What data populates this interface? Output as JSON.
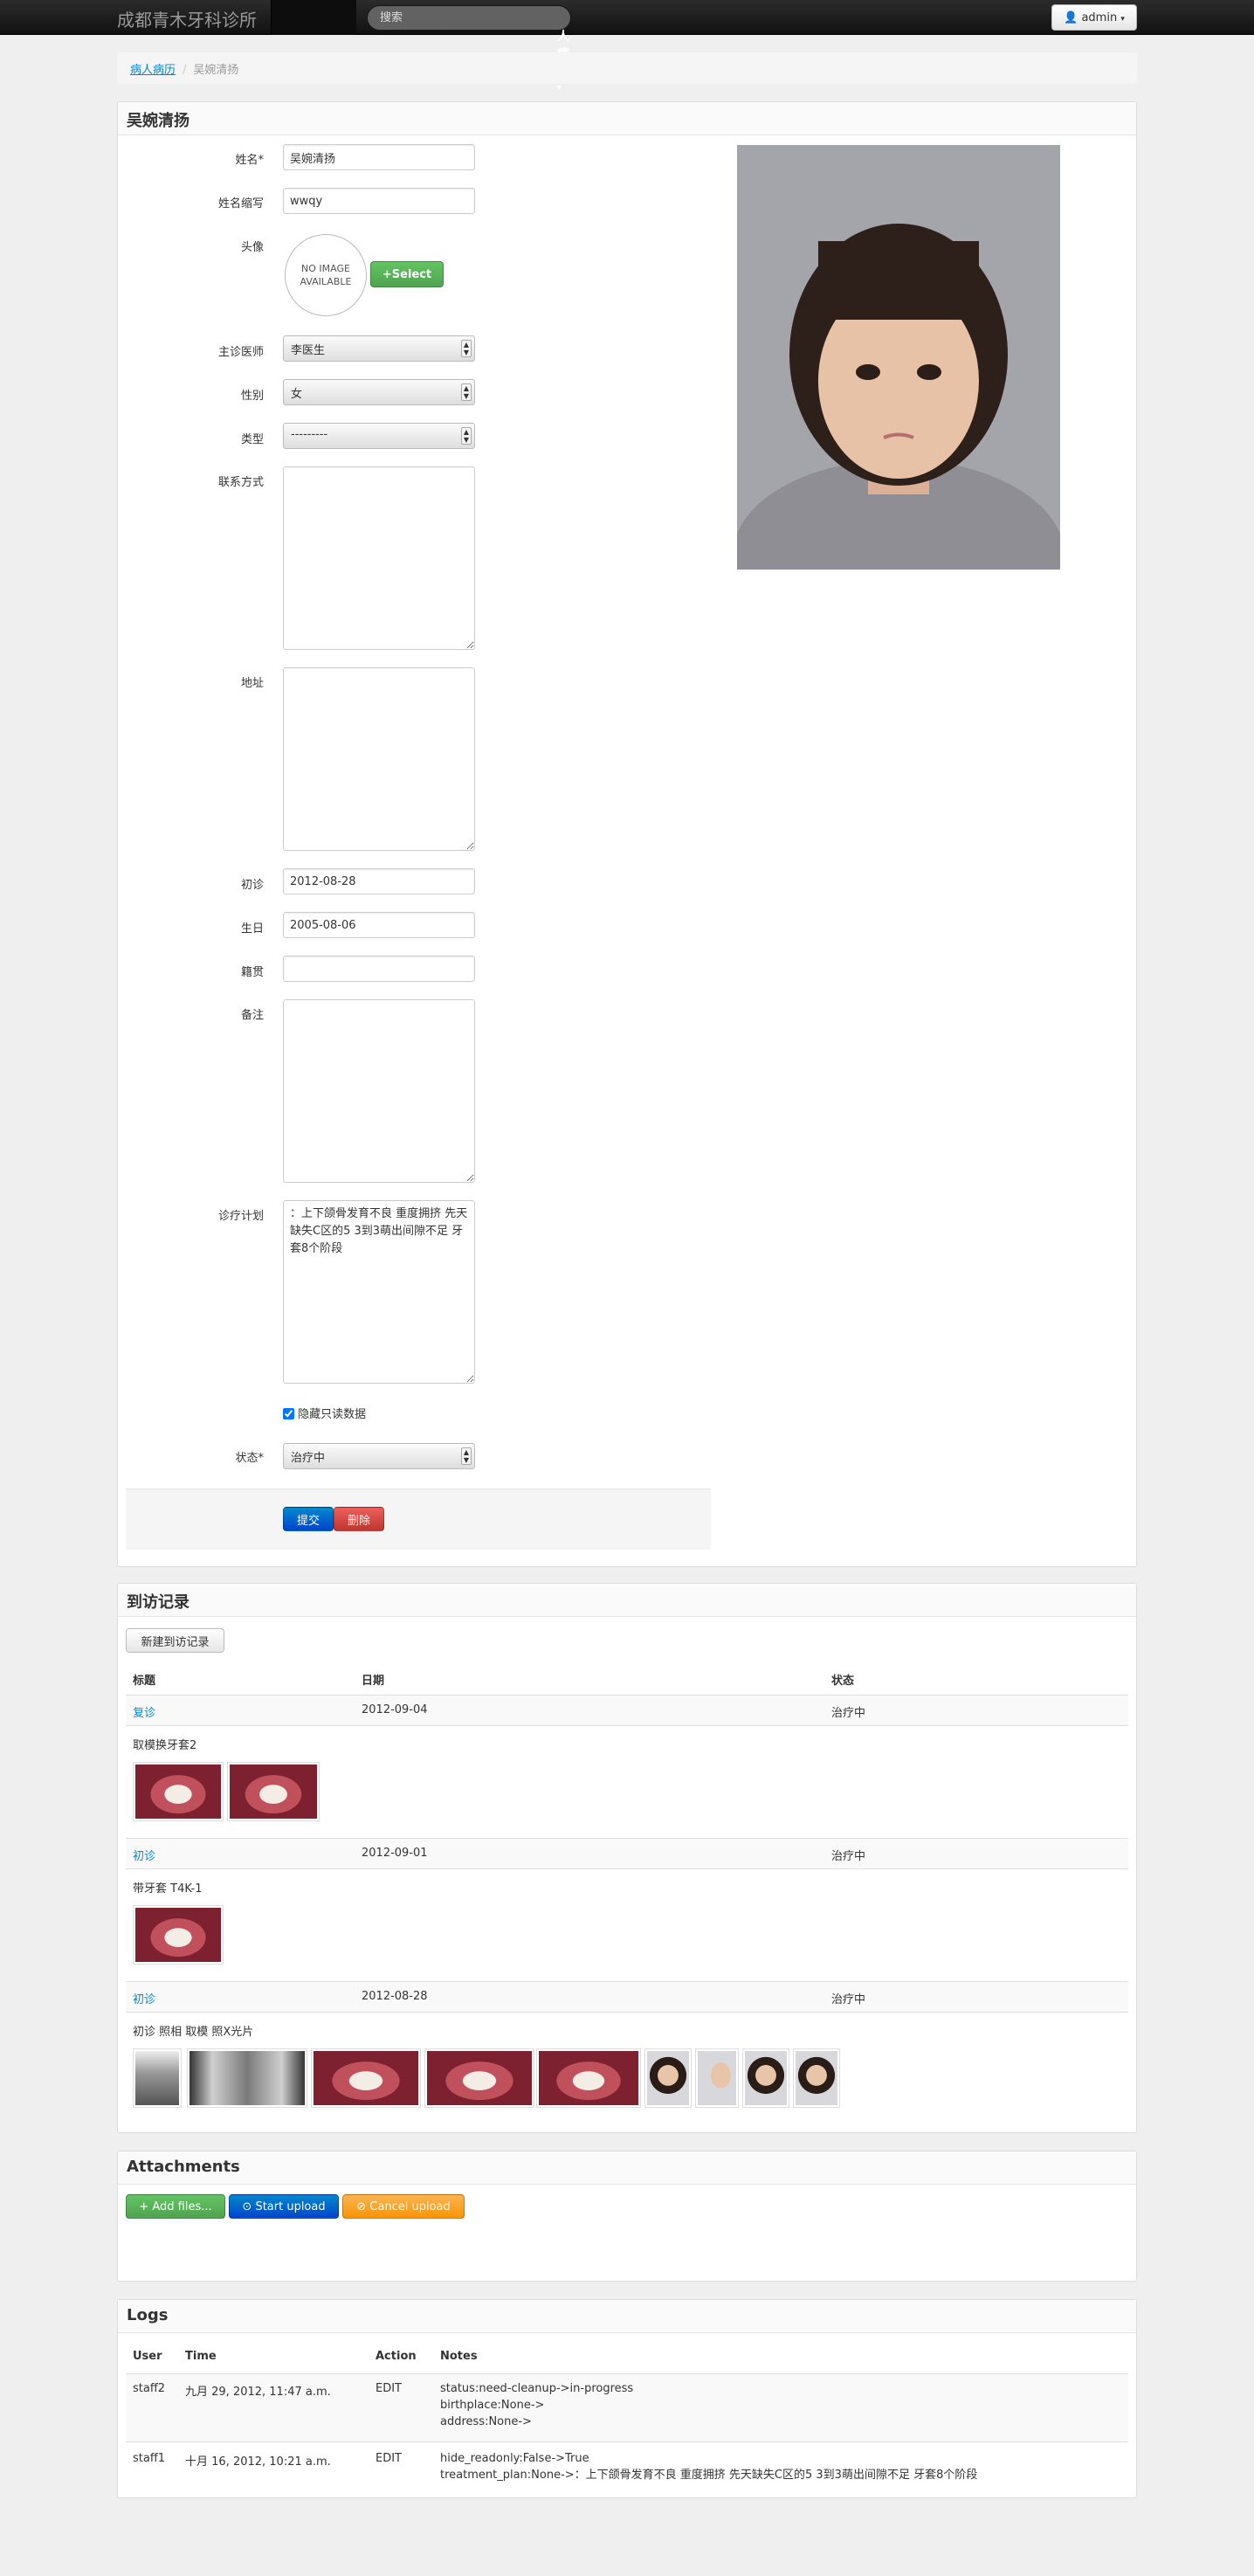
{
  "nav": {
    "brand": "成都青木牙科诊所",
    "active_menu": "病人病历",
    "search_placeholder": "搜索",
    "user": "admin"
  },
  "breadcrumb": {
    "root": "病人病历",
    "current": "吴婉清扬"
  },
  "patient": {
    "title": "吴婉清扬",
    "labels": {
      "name": "姓名*",
      "abbr": "姓名缩写",
      "avatar": "头像",
      "doctor": "主诊医师",
      "gender": "性别",
      "type": "类型",
      "contact": "联系方式",
      "address": "地址",
      "first_visit": "初诊",
      "birthday": "生日",
      "birthplace": "籍贯",
      "remark": "备注",
      "plan": "诊疗计划",
      "status": "状态*"
    },
    "values": {
      "name": "吴婉清扬",
      "abbr": "wwqy",
      "doctor": "李医生",
      "gender": "女",
      "type": "---------",
      "contact": "",
      "address": "",
      "first_visit": "2012-08-28",
      "birthday": "2005-08-06",
      "birthplace": "",
      "remark": "",
      "plan": "：上下颌骨发育不良 重度拥挤 先天缺失C区的5 3到3萌出间隙不足 牙套8个阶段",
      "status": "治疗中"
    },
    "avatar_text_1": "NO IMAGE",
    "avatar_text_2": "AVAILABLE",
    "select_button": "Select",
    "hide_readonly_label": "隐藏只读数据",
    "hide_readonly_checked": true,
    "submit": "提交",
    "delete": "删除"
  },
  "visits": {
    "title": "到访记录",
    "new_button": "新建到访记录",
    "headers": [
      "标题",
      "日期",
      "状态"
    ],
    "rows": [
      {
        "title": "复诊",
        "date": "2012-09-04",
        "status": "治疗中",
        "note": "取模换牙套2"
      },
      {
        "title": "初诊",
        "date": "2012-09-01",
        "status": "治疗中",
        "note": "带牙套 T4K-1"
      },
      {
        "title": "初诊",
        "date": "2012-08-28",
        "status": "治疗中",
        "note": "初诊 照相 取模 照X光片"
      }
    ]
  },
  "attachments": {
    "title": "Attachments",
    "add": "Add files...",
    "start": "Start upload",
    "cancel": "Cancel upload"
  },
  "logs": {
    "title": "Logs",
    "headers": [
      "User",
      "Time",
      "Action",
      "Notes"
    ],
    "rows": [
      {
        "user": "staff2",
        "time": "九月 29, 2012, 11:47 a.m.",
        "action": "EDIT",
        "notes": [
          "status:need-cleanup->in-progress",
          "birthplace:None->",
          "address:None->"
        ]
      },
      {
        "user": "staff1",
        "time": "十月 16, 2012, 10:21 a.m.",
        "action": "EDIT",
        "notes": [
          "hide_readonly:False->True",
          "treatment_plan:None->：上下颌骨发育不良 重度拥挤 先天缺失C区的5 3到3萌出间隙不足 牙套8个阶段"
        ]
      }
    ]
  },
  "colors": {
    "link": "#0088cc",
    "primary": "#0055cc",
    "danger": "#bd362f",
    "success": "#51a351",
    "warning": "#f89406"
  }
}
